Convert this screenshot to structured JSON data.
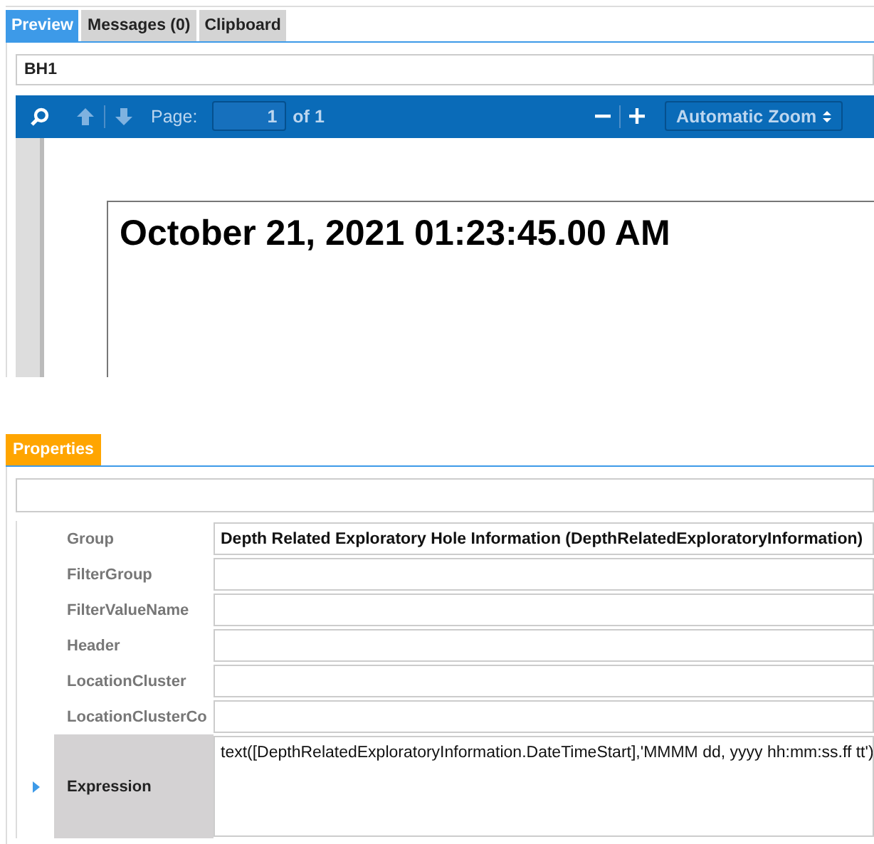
{
  "tabs": [
    {
      "label": "Preview",
      "selected": true
    },
    {
      "label": "Messages (0)",
      "selected": false
    },
    {
      "label": "Clipboard",
      "selected": false
    }
  ],
  "report_field": {
    "value": "BH1"
  },
  "viewer_toolbar": {
    "page_label": "Page:",
    "page_value": "1",
    "page_count": "of 1",
    "zoom": "Automatic Zoom"
  },
  "document": {
    "text": "October 21, 2021 01:23:45.00 AM"
  },
  "properties_tab": {
    "label": "Properties",
    "selected": true
  },
  "properties": [
    {
      "name": "Group",
      "value": "Depth Related Exploratory Hole Information (DepthRelatedExploratoryInformation)",
      "selected": false
    },
    {
      "name": "FilterGroup",
      "selected": false
    },
    {
      "name": "FilterValueName",
      "selected": false
    },
    {
      "name": "Header",
      "selected": false
    },
    {
      "name": "LocationCluster",
      "selected": false
    },
    {
      "name": "LocationClusterCo",
      "selected": false
    },
    {
      "name": "Expression",
      "value": "text([DepthRelatedExploratoryInformation.DateTimeStart],'MMMM dd, yyyy hh:mm:ss.ff tt')",
      "selected": true
    }
  ]
}
